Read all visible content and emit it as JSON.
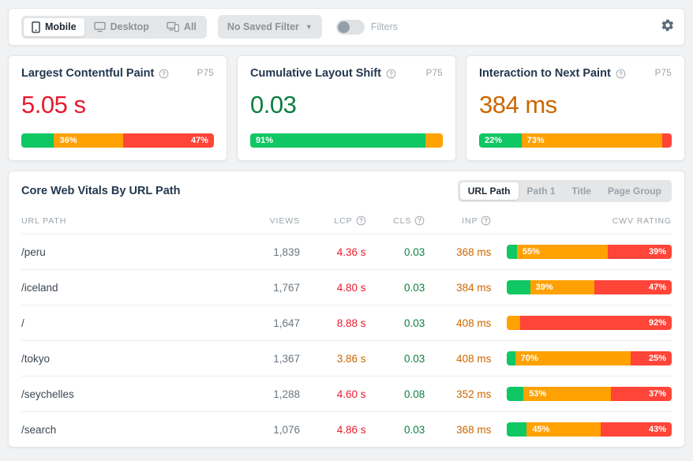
{
  "toolbar": {
    "device_options": [
      {
        "label": "Mobile",
        "icon": "mobile-icon",
        "active": true
      },
      {
        "label": "Desktop",
        "icon": "desktop-icon",
        "active": false
      },
      {
        "label": "All",
        "icon": "all-devices-icon",
        "active": false
      }
    ],
    "saved_filter": {
      "label": "No Saved Filter",
      "icon": "chevron-down-icon"
    },
    "filters_toggle": {
      "label": "Filters",
      "enabled": false
    },
    "settings": {
      "icon": "gear-icon"
    }
  },
  "metric_cards": [
    {
      "title": "Largest Contentful Paint",
      "help_icon": "question-mark-icon",
      "percentile": "P75",
      "value": "5.05 s",
      "value_color": "#e8192c",
      "distribution": [
        {
          "rating": "good",
          "percent": 17,
          "label": ""
        },
        {
          "rating": "needs-improvement",
          "percent": 36,
          "label": "36%"
        },
        {
          "rating": "poor",
          "percent": 47,
          "label": "47%"
        }
      ]
    },
    {
      "title": "Cumulative Layout Shift",
      "help_icon": "question-mark-icon",
      "percentile": "P75",
      "value": "0.03",
      "value_color": "#0a7f3f",
      "distribution": [
        {
          "rating": "good",
          "percent": 91,
          "label": "91%"
        },
        {
          "rating": "needs-improvement",
          "percent": 9,
          "label": ""
        },
        {
          "rating": "poor",
          "percent": 0,
          "label": ""
        }
      ]
    },
    {
      "title": "Interaction to Next Paint",
      "help_icon": "question-mark-icon",
      "percentile": "P75",
      "value": "384 ms",
      "value_color": "#cc6600",
      "distribution": [
        {
          "rating": "good",
          "percent": 22,
          "label": "22%"
        },
        {
          "rating": "needs-improvement",
          "percent": 73,
          "label": "73%"
        },
        {
          "rating": "poor",
          "percent": 5,
          "label": ""
        }
      ]
    }
  ],
  "table_panel": {
    "title": "Core Web Vitals By URL Path",
    "tabs": [
      {
        "label": "URL Path",
        "active": true
      },
      {
        "label": "Path 1",
        "active": false
      },
      {
        "label": "Title",
        "active": false
      },
      {
        "label": "Page Group",
        "active": false
      }
    ],
    "columns": [
      {
        "key": "url",
        "label": "URL PATH",
        "help": false
      },
      {
        "key": "views",
        "label": "VIEWS",
        "help": false
      },
      {
        "key": "lcp",
        "label": "LCP",
        "help": true
      },
      {
        "key": "cls",
        "label": "CLS",
        "help": true
      },
      {
        "key": "inp",
        "label": "INP",
        "help": true
      },
      {
        "key": "rating",
        "label": "CWV RATING",
        "help": false
      }
    ],
    "rows": [
      {
        "url": "/peru",
        "views": "1,839",
        "lcp": "4.36 s",
        "lcp_color": "#e8192c",
        "cls": "0.03",
        "cls_color": "#0a7f3f",
        "inp": "368 ms",
        "inp_color": "#cc6600",
        "distribution": [
          {
            "rating": "good",
            "percent": 6,
            "label": ""
          },
          {
            "rating": "needs-improvement",
            "percent": 55,
            "label": "55%"
          },
          {
            "rating": "poor",
            "percent": 39,
            "label": "39%"
          }
        ]
      },
      {
        "url": "/iceland",
        "views": "1,767",
        "lcp": "4.80 s",
        "lcp_color": "#e8192c",
        "cls": "0.03",
        "cls_color": "#0a7f3f",
        "inp": "384 ms",
        "inp_color": "#cc6600",
        "distribution": [
          {
            "rating": "good",
            "percent": 14,
            "label": ""
          },
          {
            "rating": "needs-improvement",
            "percent": 39,
            "label": "39%"
          },
          {
            "rating": "poor",
            "percent": 47,
            "label": "47%"
          }
        ]
      },
      {
        "url": "/",
        "views": "1,647",
        "lcp": "8.88 s",
        "lcp_color": "#e8192c",
        "cls": "0.03",
        "cls_color": "#0a7f3f",
        "inp": "408 ms",
        "inp_color": "#cc6600",
        "distribution": [
          {
            "rating": "good",
            "percent": 0,
            "label": ""
          },
          {
            "rating": "needs-improvement",
            "percent": 8,
            "label": ""
          },
          {
            "rating": "poor",
            "percent": 92,
            "label": "92%"
          }
        ]
      },
      {
        "url": "/tokyo",
        "views": "1,367",
        "lcp": "3.86 s",
        "lcp_color": "#cc6600",
        "cls": "0.03",
        "cls_color": "#0a7f3f",
        "inp": "408 ms",
        "inp_color": "#cc6600",
        "distribution": [
          {
            "rating": "good",
            "percent": 5,
            "label": ""
          },
          {
            "rating": "needs-improvement",
            "percent": 70,
            "label": "70%"
          },
          {
            "rating": "poor",
            "percent": 25,
            "label": "25%"
          }
        ]
      },
      {
        "url": "/seychelles",
        "views": "1,288",
        "lcp": "4.60 s",
        "lcp_color": "#e8192c",
        "cls": "0.08",
        "cls_color": "#0a7f3f",
        "inp": "352 ms",
        "inp_color": "#cc6600",
        "distribution": [
          {
            "rating": "good",
            "percent": 10,
            "label": ""
          },
          {
            "rating": "needs-improvement",
            "percent": 53,
            "label": "53%"
          },
          {
            "rating": "poor",
            "percent": 37,
            "label": "37%"
          }
        ]
      },
      {
        "url": "/search",
        "views": "1,076",
        "lcp": "4.86 s",
        "lcp_color": "#e8192c",
        "cls": "0.03",
        "cls_color": "#0a7f3f",
        "inp": "368 ms",
        "inp_color": "#cc6600",
        "distribution": [
          {
            "rating": "good",
            "percent": 12,
            "label": ""
          },
          {
            "rating": "needs-improvement",
            "percent": 45,
            "label": "45%"
          },
          {
            "rating": "poor",
            "percent": 43,
            "label": "43%"
          }
        ]
      }
    ]
  },
  "colors": {
    "good": "#0fc763",
    "needs_improvement": "#ffa100",
    "poor": "#ff4438",
    "heading": "#22384f",
    "muted": "#9aa2a9",
    "page_bg": "#f1f2f3"
  }
}
